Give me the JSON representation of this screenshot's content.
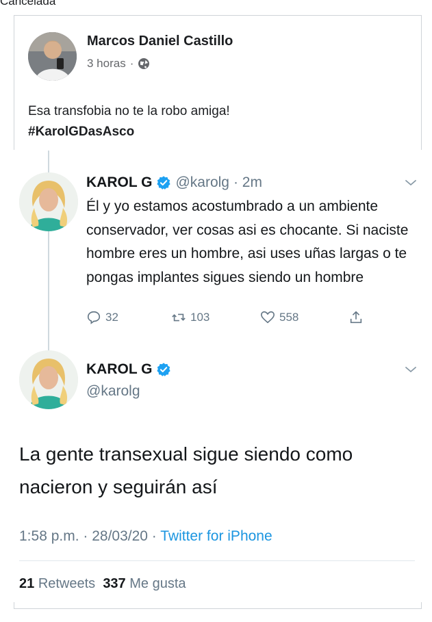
{
  "top_cut_text": "Cancelada",
  "facebook_post": {
    "author": "Marcos Daniel Castillo",
    "time": "3 horas",
    "separator": "·",
    "text": "Esa transfobia no te la robo amiga!",
    "hashtag": "#KarolGDasAsco"
  },
  "tweet_reply": {
    "name": "KAROL G",
    "handle": "@karolg",
    "time": "· 2m",
    "text": "Él y yo estamos acostumbrado a un ambiente conservador, ver cosas asi es chocante. Si naciste hombre eres un hombre, asi uses uñas largas o te pongas implantes sigues siendo un hombre",
    "reply_count": "32",
    "retweet_count": "103",
    "like_count": "558"
  },
  "tweet_main": {
    "name": "KAROL G",
    "handle": "@karolg",
    "text": "La gente transexual sigue siendo como nacieron y seguirán así",
    "timestamp": "1:58 p.m. · 28/03/20 · ",
    "source": "Twitter for iPhone",
    "retweets_count": "21",
    "retweets_label": "Retweets",
    "likes_count": "337",
    "likes_label": "Me gusta"
  },
  "colors": {
    "twitter_blue": "#1b95e0",
    "gray_text": "#657786",
    "fb_gray": "#65676b"
  }
}
